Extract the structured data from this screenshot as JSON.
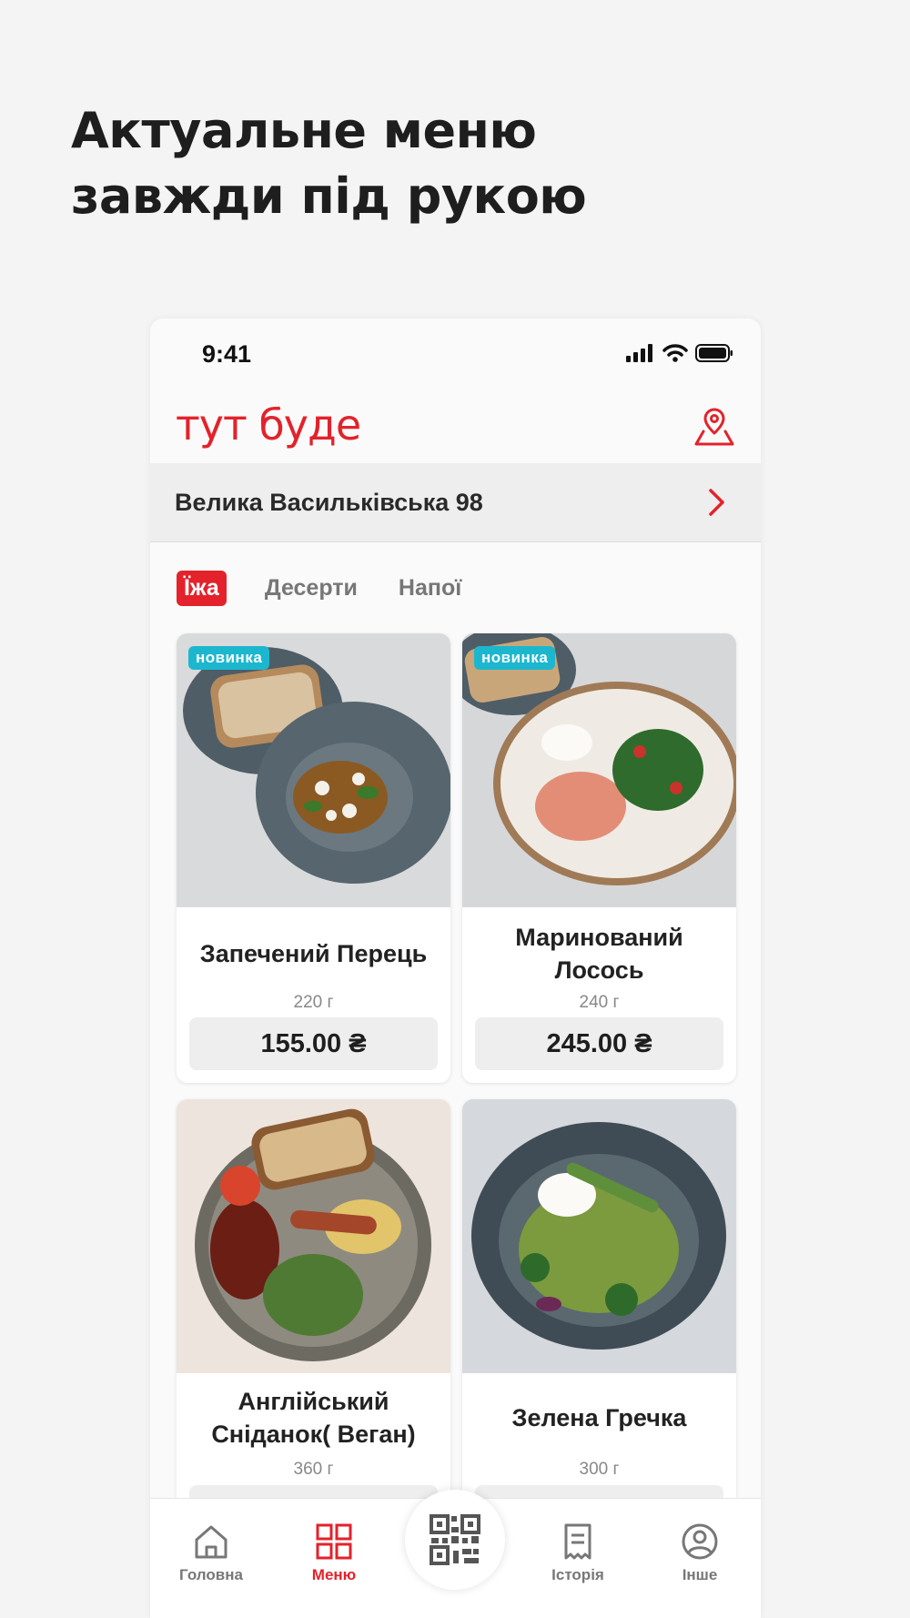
{
  "headline": {
    "line1": "Актуальне меню",
    "line2": "завжди під рукою"
  },
  "status": {
    "time": "9:41"
  },
  "appbar": {
    "brand": "тут буде",
    "map_icon": "map-pin-icon"
  },
  "address": {
    "text": "Велика Васильківська 98"
  },
  "tabs": [
    {
      "label": "Їжа",
      "active": true
    },
    {
      "label": "Десерти",
      "active": false
    },
    {
      "label": "Напої",
      "active": false
    }
  ],
  "dishes": [
    {
      "name": "Запечений Перець",
      "weight": "220 г",
      "price": "155.00 ₴",
      "badge": "новинка"
    },
    {
      "name": "Маринований Лосось",
      "weight": "240 г",
      "price": "245.00 ₴",
      "badge": "новинка"
    },
    {
      "name": "Англійський Сніданок( Веган)",
      "weight": "360 г",
      "price": "",
      "badge": ""
    },
    {
      "name": "Зелена Гречка",
      "weight": "300 г",
      "price": "",
      "badge": ""
    }
  ],
  "tabbar": {
    "home": "Головна",
    "menu": "Меню",
    "qr_icon": "qr-code-icon",
    "history": "Історія",
    "other": "Інше"
  },
  "colors": {
    "accent": "#e3222b",
    "badge": "#1cb7cf",
    "background": "#f4f4f4"
  }
}
